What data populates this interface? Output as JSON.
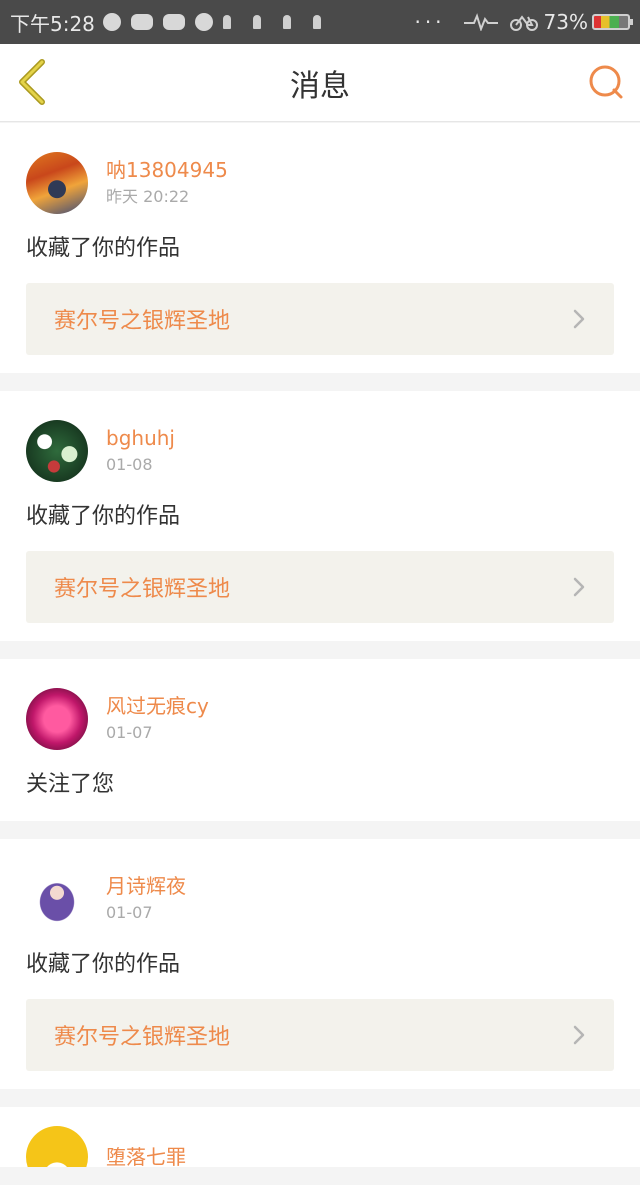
{
  "status_bar": {
    "time": "下午5:28",
    "overflow": "···",
    "battery_percent": "73%"
  },
  "header": {
    "title": "消息",
    "back_icon": "chevron-left-icon",
    "search_icon": "search-icon",
    "accent_color": "#ee8a4b"
  },
  "messages": [
    {
      "username": "呐13804945",
      "date": "昨天 20:22",
      "action": "收藏了你的作品",
      "work_title": "赛尔号之银辉圣地"
    },
    {
      "username": "bghuhj",
      "date": "01-08",
      "action": "收藏了你的作品",
      "work_title": "赛尔号之银辉圣地"
    },
    {
      "username": "风过无痕cy",
      "date": "01-07",
      "action": "关注了您"
    },
    {
      "username": "月诗辉夜",
      "date": "01-07",
      "action": "收藏了你的作品",
      "work_title": "赛尔号之银辉圣地"
    },
    {
      "username": "堕落七罪"
    }
  ]
}
